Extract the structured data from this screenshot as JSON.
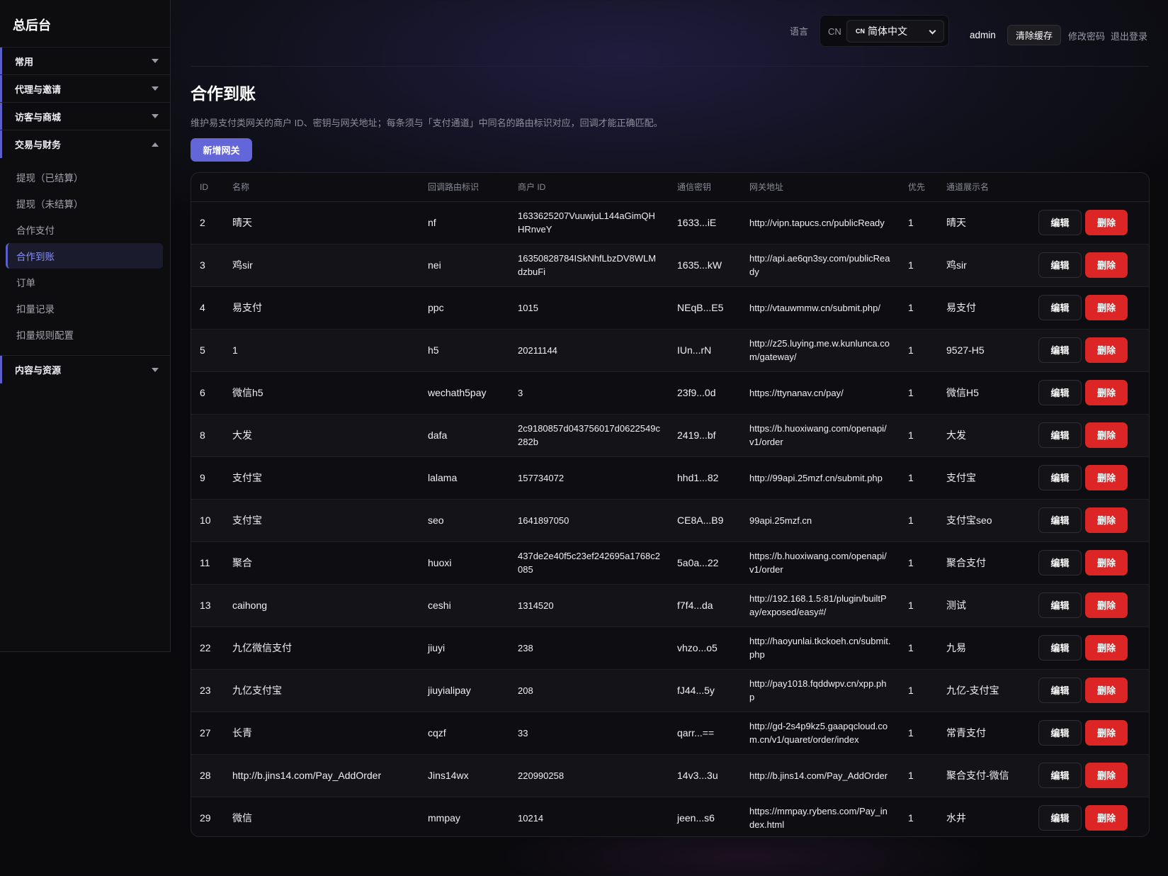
{
  "sidebar": {
    "brand": "总后台",
    "groups": [
      {
        "label": "常用",
        "expanded": false
      },
      {
        "label": "代理与邀请",
        "expanded": false
      },
      {
        "label": "访客与商城",
        "expanded": false
      },
      {
        "label": "交易与财务",
        "expanded": true,
        "items": [
          "提现（已结算）",
          "提现（未结算）",
          "合作支付",
          "合作到账",
          "订单",
          "扣量记录",
          "扣量规则配置"
        ],
        "active_item": "合作到账"
      },
      {
        "label": "内容与资源",
        "expanded": false
      }
    ]
  },
  "topbar": {
    "lang_label": "语言",
    "lang_code": "CN",
    "lang_flag": "CN",
    "lang_selected": "简体中文",
    "admin": "admin",
    "clear_cache": "清除缓存",
    "change_password": "修改密码",
    "logout": "退出登录"
  },
  "page": {
    "title": "合作到账",
    "description": "维护易支付类网关的商户 ID、密钥与网关地址；每条须与「支付通道」中同名的路由标识对应，回调才能正确匹配。",
    "add_button": "新增网关"
  },
  "table": {
    "headers": [
      "ID",
      "名称",
      "回调路由标识",
      "商户 ID",
      "通信密钥",
      "网关地址",
      "优先",
      "通道展示名",
      ""
    ],
    "edit_label": "编辑",
    "delete_label": "删除",
    "rows": [
      {
        "id": "2",
        "name": "晴天",
        "route": "nf",
        "merchant": "1633625207VuuwjuL144aGimQHHRnveY",
        "key": "1633...iE",
        "gateway": "http://vipn.tapucs.cn/publicReady",
        "priority": "1",
        "display": "晴天"
      },
      {
        "id": "3",
        "name": "鸡sir",
        "route": "nei",
        "merchant": "16350828784ISkNhfLbzDV8WLMdzbuFi",
        "key": "1635...kW",
        "gateway": "http://api.ae6qn3sy.com/publicReady",
        "priority": "1",
        "display": "鸡sir"
      },
      {
        "id": "4",
        "name": "易支付",
        "route": "ppc",
        "merchant": "1015",
        "key": "NEqB...E5",
        "gateway": "http://vtauwmmw.cn/submit.php/",
        "priority": "1",
        "display": "易支付"
      },
      {
        "id": "5",
        "name": "1",
        "route": "h5",
        "merchant": "20211144",
        "key": "IUn...rN",
        "gateway": "http://z25.luying.me.w.kunlunca.com/gateway/",
        "priority": "1",
        "display": "9527-H5"
      },
      {
        "id": "6",
        "name": "微信h5",
        "route": "wechath5pay",
        "merchant": "3",
        "key": "23f9...0d",
        "gateway": "https://ttynanav.cn/pay/",
        "priority": "1",
        "display": "微信H5"
      },
      {
        "id": "8",
        "name": "大发",
        "route": "dafa",
        "merchant": "2c9180857d043756017d0622549c282b",
        "key": "2419...bf",
        "gateway": "https://b.huoxiwang.com/openapi/v1/order",
        "priority": "1",
        "display": "大发"
      },
      {
        "id": "9",
        "name": "支付宝",
        "route": "lalama",
        "merchant": "157734072",
        "key": "hhd1...82",
        "gateway": "http://99api.25mzf.cn/submit.php",
        "priority": "1",
        "display": "支付宝"
      },
      {
        "id": "10",
        "name": "支付宝",
        "route": "seo",
        "merchant": "1641897050",
        "key": "CE8A...B9",
        "gateway": "99api.25mzf.cn",
        "priority": "1",
        "display": "支付宝seo"
      },
      {
        "id": "11",
        "name": "聚合",
        "route": "huoxi",
        "merchant": "437de2e40f5c23ef242695a1768c2085",
        "key": "5a0a...22",
        "gateway": "https://b.huoxiwang.com/openapi/v1/order",
        "priority": "1",
        "display": "聚合支付"
      },
      {
        "id": "13",
        "name": "caihong",
        "route": "ceshi",
        "merchant": "1314520",
        "key": "f7f4...da",
        "gateway": "http://192.168.1.5:81/plugin/builtPay/exposed/easy#/",
        "priority": "1",
        "display": "测试"
      },
      {
        "id": "22",
        "name": "九亿微信支付",
        "route": "jiuyi",
        "merchant": "238",
        "key": "vhzo...o5",
        "gateway": "http://haoyunlai.tkckoeh.cn/submit.php",
        "priority": "1",
        "display": "九易"
      },
      {
        "id": "23",
        "name": "九亿支付宝",
        "route": "jiuyialipay",
        "merchant": "208",
        "key": "fJ44...5y",
        "gateway": "http://pay1018.fqddwpv.cn/xpp.php",
        "priority": "1",
        "display": "九亿-支付宝"
      },
      {
        "id": "27",
        "name": "长青",
        "route": "cqzf",
        "merchant": "33",
        "key": "qarr...==",
        "gateway": "http://gd-2s4p9kz5.gaapqcloud.com.cn/v1/quaret/order/index",
        "priority": "1",
        "display": "常青支付"
      },
      {
        "id": "28",
        "name": "http://b.jins14.com/Pay_AddOrder",
        "route": "Jins14wx",
        "merchant": "220990258",
        "key": "14v3...3u",
        "gateway": "http://b.jins14.com/Pay_AddOrder",
        "priority": "1",
        "display": "聚合支付-微信"
      },
      {
        "id": "29",
        "name": "微信",
        "route": "mmpay",
        "merchant": "10214",
        "key": "jeen...s6",
        "gateway": "https://mmpay.rybens.com/Pay_index.html",
        "priority": "1",
        "display": "水井"
      }
    ]
  }
}
